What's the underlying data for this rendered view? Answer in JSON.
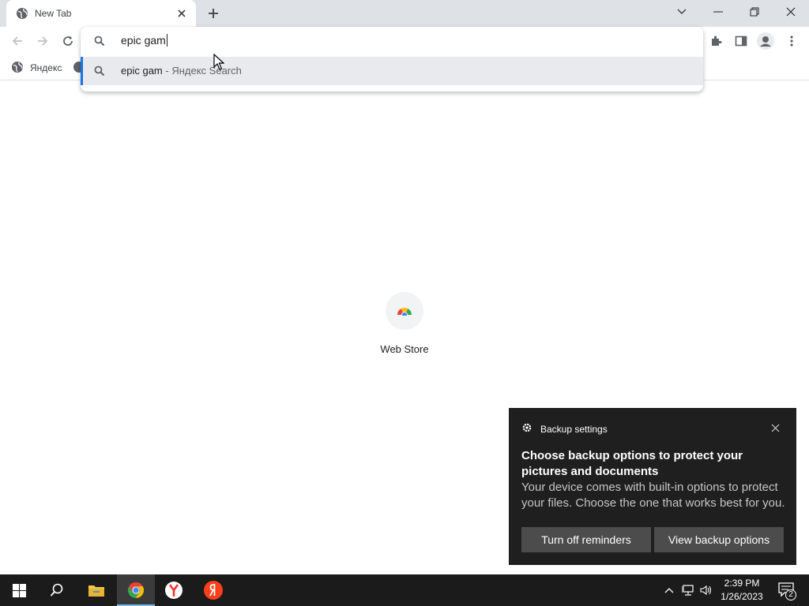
{
  "browser": {
    "tab": {
      "title": "New Tab"
    },
    "window_controls": [
      "minimize",
      "restore",
      "close"
    ]
  },
  "bookmarks": [
    {
      "label": "Яндекс",
      "icon": "globe-icon"
    }
  ],
  "omnibox": {
    "query": "epic gam",
    "suggestions": [
      {
        "text": "epic gam",
        "separator": "-",
        "engine": "Яндекс Search"
      }
    ]
  },
  "new_tab_page": {
    "shortcuts": [
      {
        "label": "Web Store",
        "icon": "chrome-web-store-icon"
      }
    ]
  },
  "notification": {
    "app": "Backup settings",
    "title": "Choose backup options to protect your pictures and documents",
    "body": "Your device comes with built-in options to protect your files. Choose the one that works best for you.",
    "buttons": {
      "left": "Turn off reminders",
      "right": "View backup options"
    }
  },
  "taskbar": {
    "pinned": [
      "start-icon",
      "search-icon",
      "file-explorer-icon",
      "chrome-icon",
      "yandex-browser-icon",
      "yandex-icon"
    ],
    "clock": {
      "time": "2:39 PM",
      "date": "1/26/2023"
    },
    "notifications_count": "2"
  },
  "colors": {
    "accent": "#1a73e8",
    "toast_bg": "#1f1f1f",
    "taskbar_bg": "#1b1b1b"
  }
}
